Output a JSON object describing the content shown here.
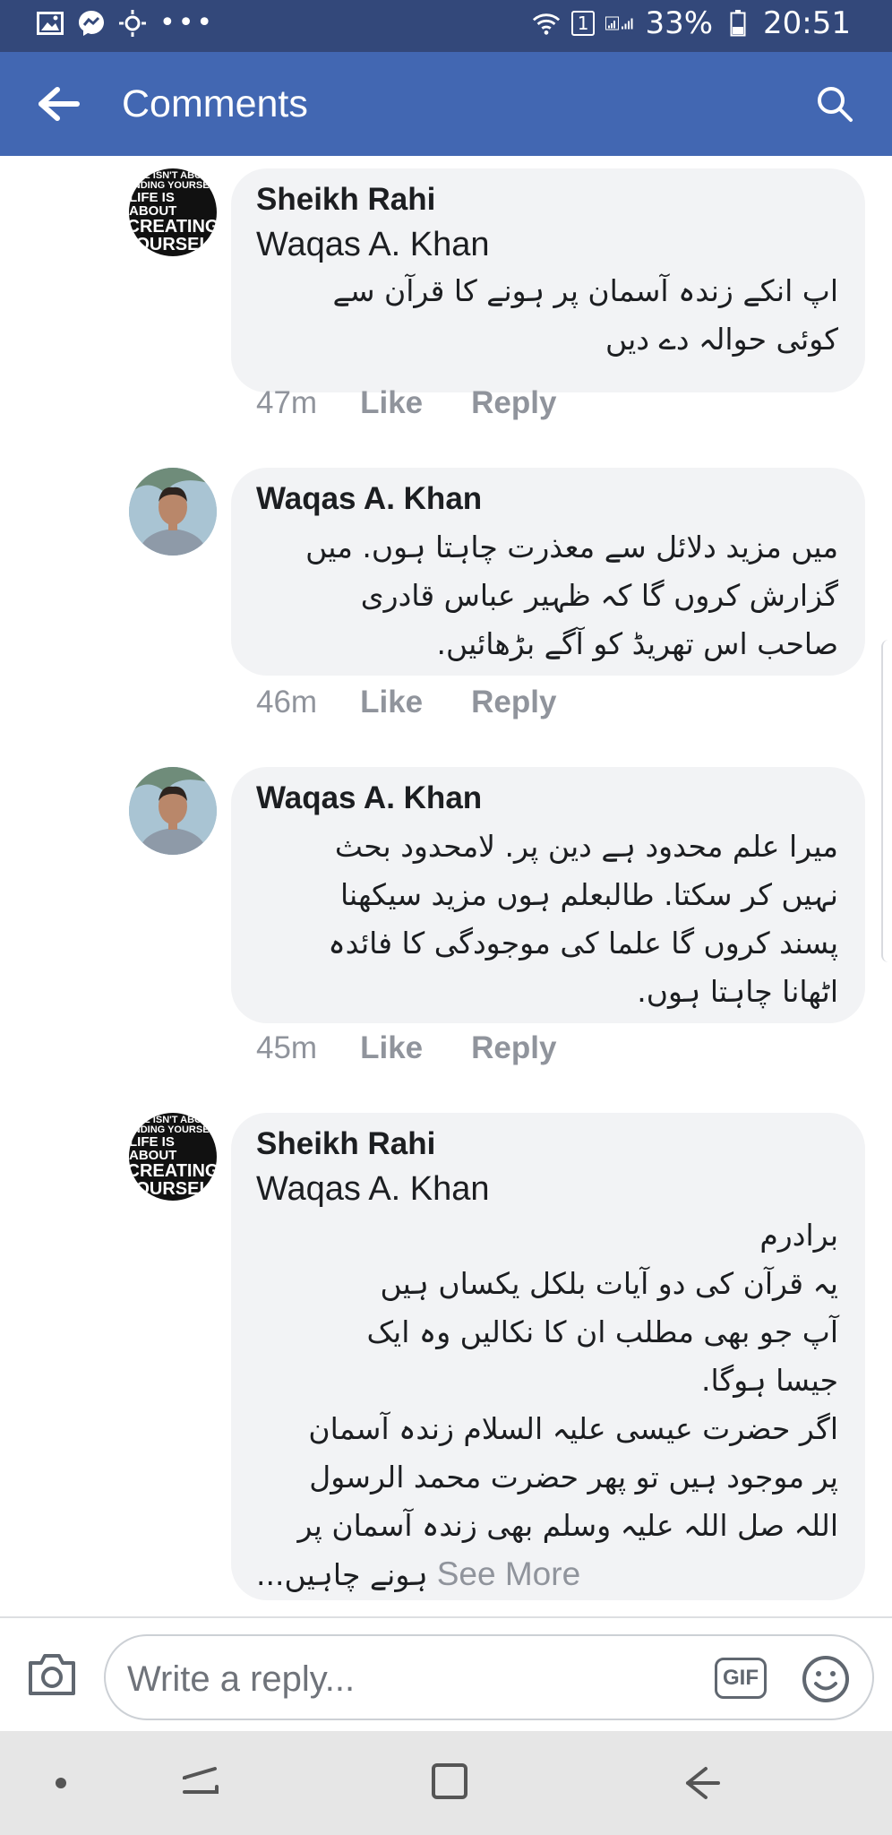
{
  "status_bar": {
    "sim_slot": "1",
    "battery": "33%",
    "time": "20:51",
    "bg_color": "#33487a",
    "left_icons": [
      "gallery-icon",
      "messenger-icon",
      "brightness-icon",
      "more-dots-icon"
    ],
    "right_icons": [
      "wifi-icon",
      "signal-icon",
      "battery-icon"
    ]
  },
  "app_bar": {
    "title": "Comments",
    "bg_color": "#4267b2",
    "back_icon": "arrow-left-icon",
    "search_icon": "search-icon"
  },
  "comments": [
    {
      "author": "Sheikh Rahi",
      "avatar": "quote-avatar",
      "avatar_text": [
        "E ISN'T ABO",
        "INDING YOURSEL",
        "LIFE IS ABOUT",
        "CREATING",
        "OURSEL"
      ],
      "mention": "Waqas A. Khan",
      "lines": [
        "اپ انکے زندہ آسمان پر ہونے کا قرآن سے",
        "کوئی حوالہ دے دیں"
      ],
      "time": "47m",
      "like": "Like",
      "reply": "Reply"
    },
    {
      "author": "Waqas A. Khan",
      "avatar": "photo-avatar",
      "mention": "",
      "lines": [
        "میں مزید دلائل سے معذرت چاہتا ہوں. میں",
        "گزارش کروں گا کہ ظہیر عباس قادری",
        "صاحب اس تھریڈ کو آگے بڑھائیں."
      ],
      "time": "46m",
      "like": "Like",
      "reply": "Reply"
    },
    {
      "author": "Waqas A. Khan",
      "avatar": "photo-avatar",
      "mention": "",
      "lines": [
        "میرا علم محدود ہے دین پر. لامحدود بحث",
        "نہیں کر سکتا. طالبعلم ہوں مزید سیکھنا",
        "پسند کروں گا علما کی موجودگی کا فائدہ",
        "اٹھانا چاہتا ہوں."
      ],
      "time": "45m",
      "like": "Like",
      "reply": "Reply"
    },
    {
      "author": "Sheikh Rahi",
      "avatar": "quote-avatar",
      "avatar_text": [
        "E ISN'T ABO",
        "INDING YOURSEL",
        "LIFE IS ABOUT",
        "CREATING",
        "OURSEL"
      ],
      "mention": "Waqas A. Khan",
      "lines": [
        "برادرم",
        "یہ قرآن کی دو آیات بلکل یکساں ہیں",
        "آپ جو بھی مطلب ان کا نکالیں وہ ایک",
        "جیسا ہوگا.",
        "اگر حضرت عیسی علیہ السلام زندہ آسمان",
        "پر موجود ہیں تو پھر حضرت محمد الرسول",
        "اللہ صل اللہ علیہ وسلم بھی زندہ آسمان پر"
      ],
      "last_line": "ہونے چاہیں...",
      "see_more": "See More"
    }
  ],
  "composer": {
    "placeholder": "Write a reply...",
    "gif_label": "GIF",
    "camera_icon": "camera-icon",
    "emoji_icon": "emoji-icon"
  },
  "nav_bar": {
    "icons": [
      "nav-dot-icon",
      "recent-apps-icon",
      "home-icon",
      "back-icon"
    ]
  }
}
